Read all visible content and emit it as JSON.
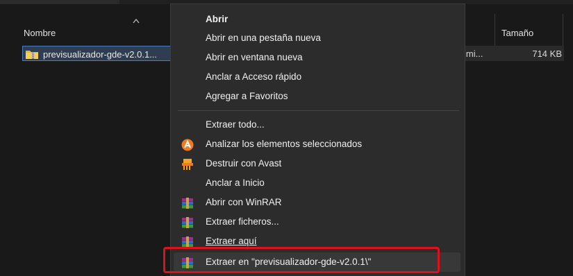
{
  "explorer": {
    "columns": {
      "name": "Nombre",
      "size": "Tamaño"
    },
    "file": {
      "name": "previsualizador-gde-v2.0.1...",
      "type_partial": "imi...",
      "size": "714 KB",
      "icon": "zip-folder-icon"
    }
  },
  "context_menu": {
    "items": [
      {
        "label": "Abrir",
        "bold": true,
        "icon": null
      },
      {
        "label": "Abrir en una pestaña nueva",
        "icon": null
      },
      {
        "label": "Abrir en ventana nueva",
        "icon": null
      },
      {
        "label": "Anclar a Acceso rápido",
        "icon": null
      },
      {
        "label": "Agregar a Favoritos",
        "icon": null
      },
      {
        "label": "Extraer todo...",
        "icon": null
      },
      {
        "label": "Analizar los elementos seleccionados",
        "icon": "avast-icon"
      },
      {
        "label": "Destruir con Avast",
        "icon": "shredder-icon"
      },
      {
        "label": "Anclar a Inicio",
        "icon": null
      },
      {
        "label": "Abrir con WinRAR",
        "icon": "winrar-icon"
      },
      {
        "label": "Extraer ficheros...",
        "icon": "winrar-icon"
      },
      {
        "label": "Extraer aquí",
        "icon": "winrar-icon"
      },
      {
        "label": "Extraer en \"previsualizador-gde-v2.0.1\\\"",
        "icon": "winrar-icon",
        "hovered": true,
        "highlighted": true
      }
    ]
  },
  "colors": {
    "highlight_border": "#e0111b",
    "selection": "#2e3d52",
    "menu_bg": "#2c2c2c"
  }
}
